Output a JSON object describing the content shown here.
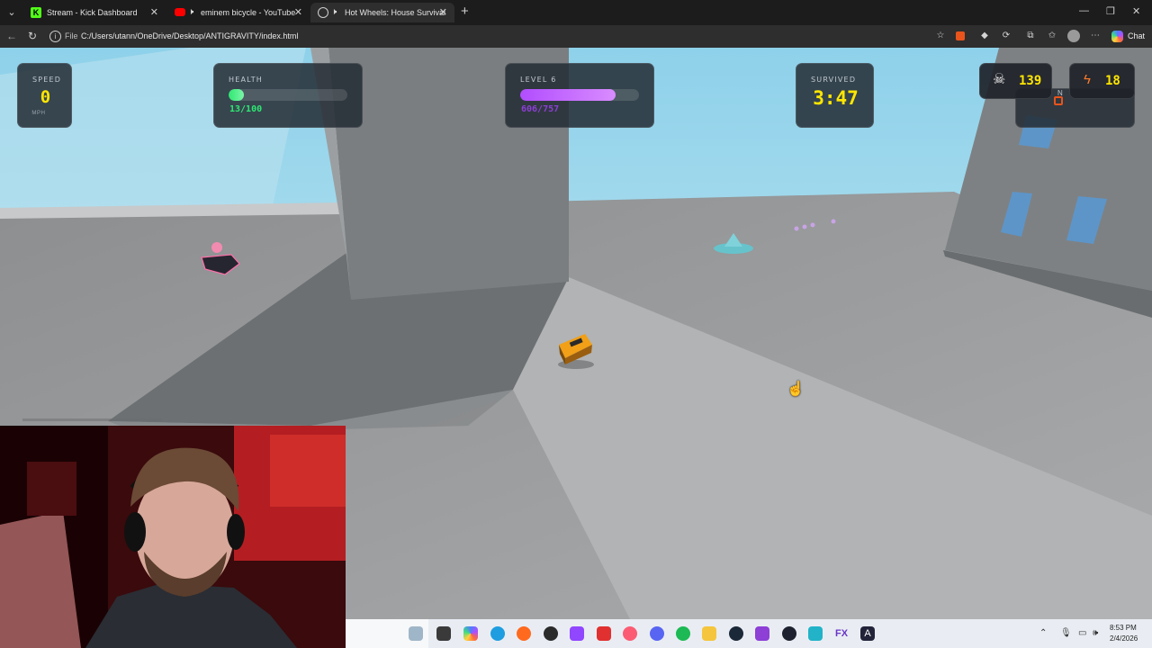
{
  "browser": {
    "tabs": [
      {
        "title": "Stream - Kick Dashboard",
        "icon": "kick-icon",
        "color": "#53fc18",
        "active": false
      },
      {
        "title": "eminem bicycle - YouTube",
        "icon": "youtube-icon",
        "color": "#ff0000",
        "active": false
      },
      {
        "title": "Hot Wheels: House Survival",
        "icon": "globe-icon",
        "color": "#cfcfcf",
        "active": true
      }
    ],
    "new_tab_label": "+",
    "url_scheme": "File",
    "url": "C:/Users/utann/OneDrive/Desktop/ANTIGRAVITY/index.html",
    "chat_label": "Chat"
  },
  "hud": {
    "speed": {
      "label": "SPEED",
      "value": "0",
      "unit": "MPH"
    },
    "health": {
      "label": "HEALTH",
      "text": "13/100",
      "fraction": 0.13,
      "color": "#2ee872"
    },
    "level": {
      "label": "LEVEL 6",
      "text": "606/757",
      "fraction": 0.8,
      "color": "#b14dff"
    },
    "survived": {
      "label": "SURVIVED",
      "value": "3:47"
    },
    "kills": {
      "value": "139",
      "icon": "skull-icon"
    },
    "energy": {
      "value": "18",
      "icon": "lightning-icon"
    },
    "partial_label": "N"
  },
  "taskbar": {
    "time": "8:53 PM",
    "date": "2/4/2026",
    "apps": [
      "file-explorer-icon",
      "taskview-icon",
      "copilot-icon",
      "edge-icon",
      "firefox-icon",
      "obs-icon",
      "twitch-icon",
      "app-red-icon",
      "itunes-icon",
      "discord-icon",
      "spotify-icon",
      "folder-icon",
      "steam-icon",
      "app-purple-icon",
      "app-dark-icon",
      "app-teal-icon",
      "fx-icon",
      "antigravity-icon"
    ],
    "fx_label": "FX"
  }
}
